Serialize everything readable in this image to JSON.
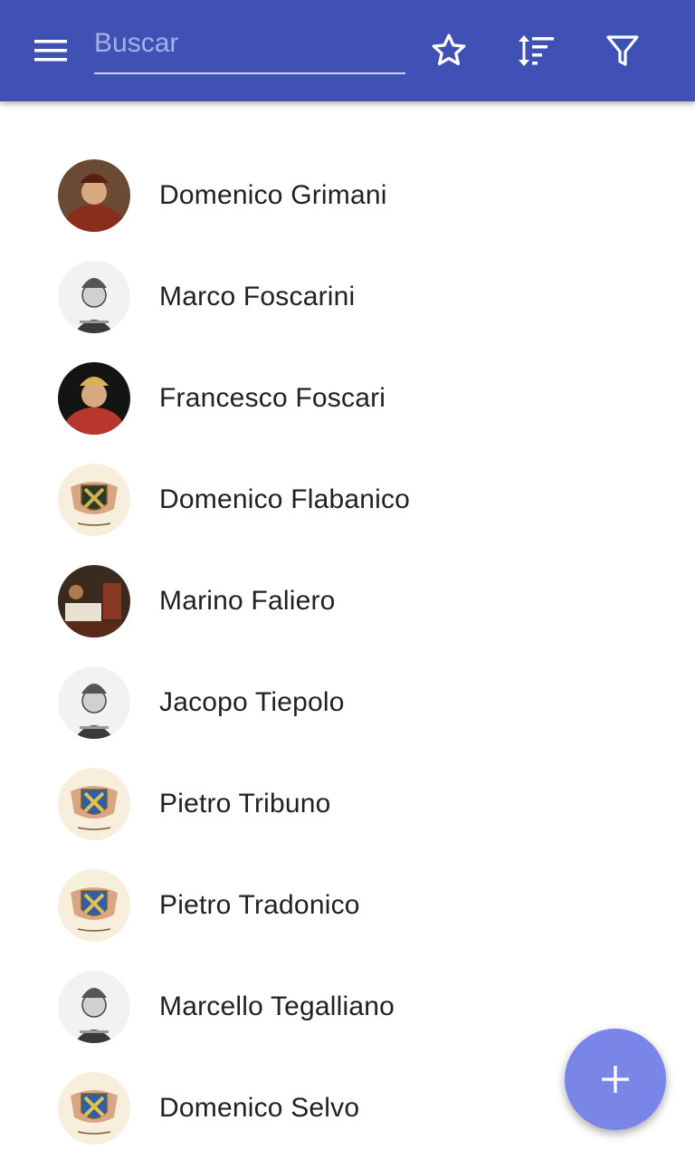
{
  "app_bar": {
    "background": "#3f51b5",
    "menu_icon": "menu-icon",
    "search": {
      "placeholder": "Buscar",
      "value": ""
    },
    "actions": [
      "star-outline-icon",
      "sort-icon",
      "filter-icon"
    ]
  },
  "doges": [
    {
      "name": "Domenico Grimani",
      "avatar": "portrait-painting"
    },
    {
      "name": "Marco Foscarini",
      "avatar": "portrait-engraving"
    },
    {
      "name": "Francesco Foscari",
      "avatar": "portrait-painting"
    },
    {
      "name": "Domenico Flabanico",
      "avatar": "coat-of-arms"
    },
    {
      "name": "Marino Faliero",
      "avatar": "painting-scene"
    },
    {
      "name": "Jacopo Tiepolo",
      "avatar": "portrait-engraving"
    },
    {
      "name": "Pietro Tribuno",
      "avatar": "coat-of-arms"
    },
    {
      "name": "Pietro Tradonico",
      "avatar": "coat-of-arms"
    },
    {
      "name": "Marcello Tegalliano",
      "avatar": "portrait-engraving"
    },
    {
      "name": "Domenico Selvo",
      "avatar": "coat-of-arms"
    }
  ],
  "fab": {
    "icon": "add-icon",
    "color": "#7986e8"
  }
}
